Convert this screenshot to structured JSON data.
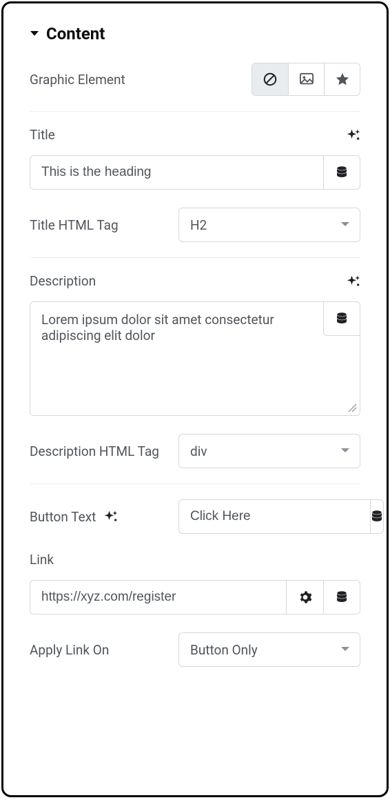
{
  "section": {
    "title": "Content"
  },
  "graphic_element": {
    "label": "Graphic Element",
    "selected": "none"
  },
  "title_field": {
    "label": "Title",
    "value": "This is the heading"
  },
  "title_html_tag": {
    "label": "Title HTML Tag",
    "value": "H2"
  },
  "description": {
    "label": "Description",
    "value": "Lorem ipsum dolor sit amet consectetur adipiscing elit dolor"
  },
  "description_html_tag": {
    "label": "Description HTML Tag",
    "value": "div"
  },
  "button_text": {
    "label": "Button Text",
    "value": "Click Here"
  },
  "link": {
    "label": "Link",
    "value": "https://xyz.com/register"
  },
  "apply_link_on": {
    "label": "Apply Link On",
    "value": "Button Only"
  }
}
